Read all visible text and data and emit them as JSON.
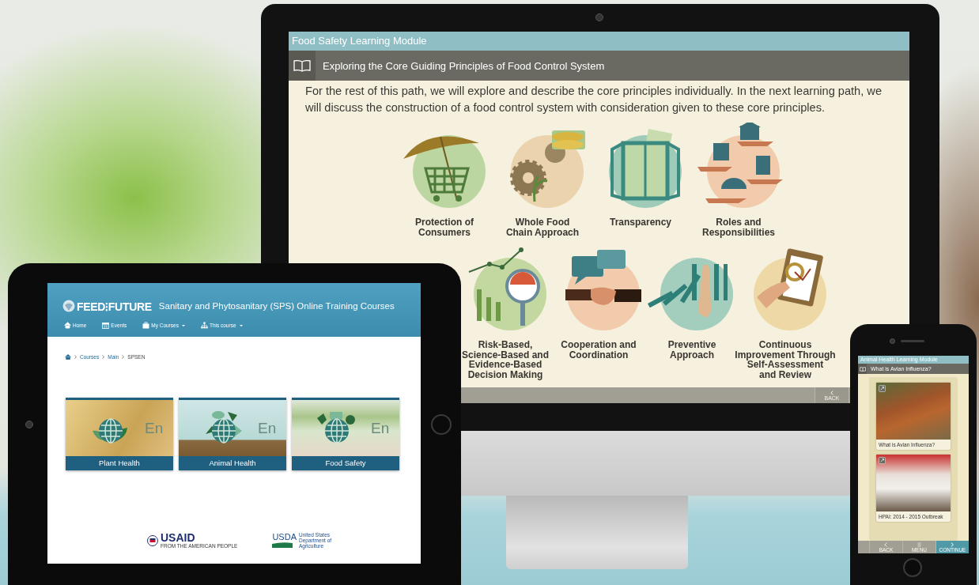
{
  "monitor": {
    "module_title": "Food Safety Learning Module",
    "lesson_title": "Exploring the Core Guiding Principles of Food Control System",
    "intro": "For the rest of this path, we will explore and describe the core principles individually. In the next learning path, we will discuss the construction of a food control system with consideration given to these core principles.",
    "principle_rows": [
      [
        {
          "kind": "umbrella-cart",
          "label": "Protection of\nConsumers"
        },
        {
          "kind": "gears-corn",
          "label": "Whole Food\nChain Approach"
        },
        {
          "kind": "window",
          "label": "Transparency"
        },
        {
          "kind": "hands",
          "label": "Roles and\nResponsibilities"
        }
      ],
      [
        {
          "kind": "chart-gauge",
          "label": "Risk-Based,\nScience-Based and\nEvidence-Based\nDecision Making"
        },
        {
          "kind": "handshake",
          "label": "Cooperation and\nCoordination"
        },
        {
          "kind": "dominoes",
          "label": "Preventive\nApproach"
        },
        {
          "kind": "clipboard",
          "label": "Continuous\nImprovement Through\nSelf-Assessment\nand Review"
        }
      ]
    ],
    "back_button": "BACK"
  },
  "tablet": {
    "logo": "FEED⁝FUTURE",
    "site_title": "Sanitary and Phytosanitary (SPS) Online Training Courses",
    "nav": [
      {
        "kind": "home",
        "label": "Home",
        "dropdown": false
      },
      {
        "kind": "calendar",
        "label": "Events",
        "dropdown": false
      },
      {
        "kind": "briefcase",
        "label": "My Courses",
        "dropdown": true
      },
      {
        "kind": "sitemap",
        "label": "This course",
        "dropdown": true
      }
    ],
    "breadcrumb": [
      "Courses",
      "Main",
      "SPSEN"
    ],
    "courses": [
      {
        "kind": "plant",
        "label": "Plant Health",
        "language": "En"
      },
      {
        "kind": "animal",
        "label": "Animal Health",
        "language": "En"
      },
      {
        "kind": "food",
        "label": "Food Safety",
        "language": "En"
      }
    ],
    "partners": [
      {
        "kind": "usaid",
        "name": "USAID",
        "tagline": "FROM THE AMERICAN PEOPLE"
      },
      {
        "kind": "usda",
        "name": "USDA",
        "tagline": "United States Department of Agriculture"
      }
    ]
  },
  "phone": {
    "module_title": "Animal Health Learning Module",
    "lesson_title": "What is Avian Influenza?",
    "media": [
      {
        "caption": "What is Avian Influenza?"
      },
      {
        "caption": "HPAI: 2014 - 2015 Outbreak"
      }
    ],
    "nav": [
      {
        "kind": "back",
        "label": "BACK",
        "primary": false
      },
      {
        "kind": "menu",
        "label": "MENU",
        "primary": false
      },
      {
        "kind": "continue",
        "label": "CONTINUE",
        "primary": true
      }
    ]
  }
}
